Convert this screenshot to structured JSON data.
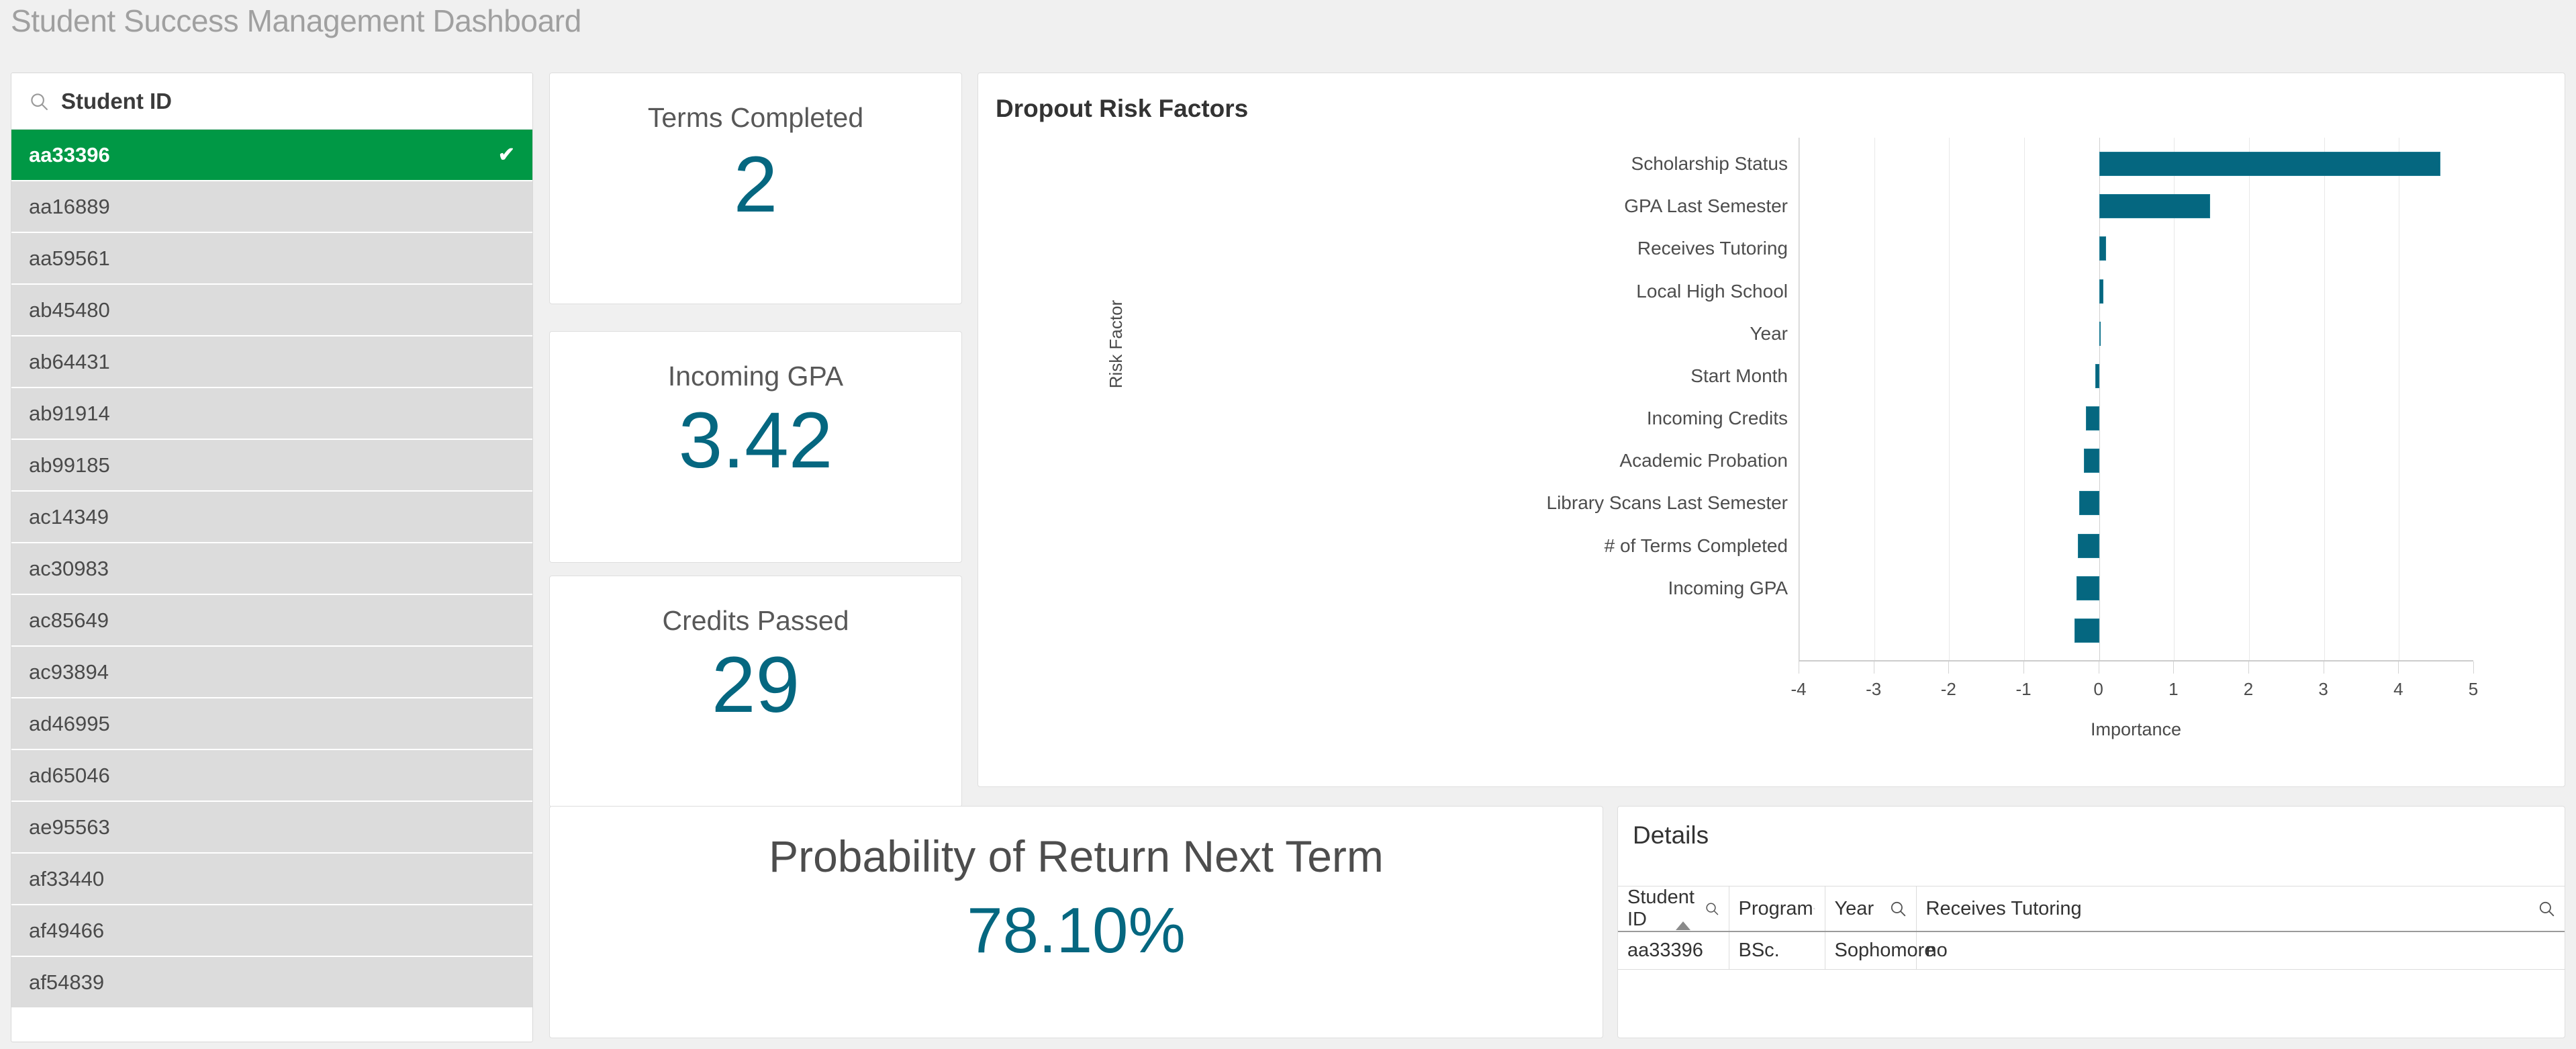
{
  "header": {
    "title": "Student Success Management Dashboard"
  },
  "filter_pane": {
    "search": {
      "placeholder": "Student ID",
      "icon": "search-icon"
    },
    "selected_id": "aa33396",
    "check_glyph": "✔",
    "students": [
      {
        "id": "aa33396",
        "selected": true
      },
      {
        "id": "aa16889",
        "selected": false
      },
      {
        "id": "aa59561",
        "selected": false
      },
      {
        "id": "ab45480",
        "selected": false
      },
      {
        "id": "ab64431",
        "selected": false
      },
      {
        "id": "ab91914",
        "selected": false
      },
      {
        "id": "ab99185",
        "selected": false
      },
      {
        "id": "ac14349",
        "selected": false
      },
      {
        "id": "ac30983",
        "selected": false
      },
      {
        "id": "ac85649",
        "selected": false
      },
      {
        "id": "ac93894",
        "selected": false
      },
      {
        "id": "ad46995",
        "selected": false
      },
      {
        "id": "ad65046",
        "selected": false
      },
      {
        "id": "ae95563",
        "selected": false
      },
      {
        "id": "af33440",
        "selected": false
      },
      {
        "id": "af49466",
        "selected": false
      },
      {
        "id": "af54839",
        "selected": false
      }
    ]
  },
  "kpis": {
    "terms_completed": {
      "title": "Terms Completed",
      "value": "2"
    },
    "incoming_gpa": {
      "title": "Incoming GPA",
      "value": "3.42"
    },
    "credits_passed": {
      "title": "Credits Passed",
      "value": "29"
    },
    "probability": {
      "title": "Probability of Return Next Term",
      "value": "78.10%"
    }
  },
  "chart_card": {
    "title": "Dropout Risk Factors"
  },
  "chart_data": {
    "type": "bar",
    "orientation": "horizontal",
    "title": "Dropout Risk Factors",
    "xlabel": "Importance",
    "ylabel": "Risk Factor",
    "xlim": [
      -4,
      5
    ],
    "xticks": [
      -4,
      -3,
      -2,
      -1,
      0,
      1,
      2,
      3,
      4,
      5
    ],
    "grid": true,
    "legend": "none",
    "bar_color": "#056780",
    "categories": [
      "Scholarship Status",
      "GPA Last Semester",
      "Receives Tutoring",
      "Local High School",
      "Year",
      "Start Month",
      "Incoming Credits",
      "Academic Probation",
      "Library Scans Last Semester",
      "# of Terms Completed",
      "Incoming GPA",
      ""
    ],
    "values": [
      4.55,
      1.48,
      0.09,
      0.06,
      0.005,
      -0.05,
      -0.18,
      -0.2,
      -0.27,
      -0.28,
      -0.3,
      -0.33
    ]
  },
  "details": {
    "title": "Details",
    "search_icon": "search-icon",
    "sorted_column": "Student ID",
    "columns": [
      "Student ID",
      "Program",
      "Year",
      "Receives Tutoring"
    ],
    "rows": [
      {
        "student_id": "aa33396",
        "program": "BSc.",
        "year": "Sophomore",
        "receives_tutoring": "no"
      }
    ]
  },
  "colors": {
    "accent_teal": "#056780",
    "selection_green": "#009845",
    "page_background": "#f0f0f0"
  }
}
